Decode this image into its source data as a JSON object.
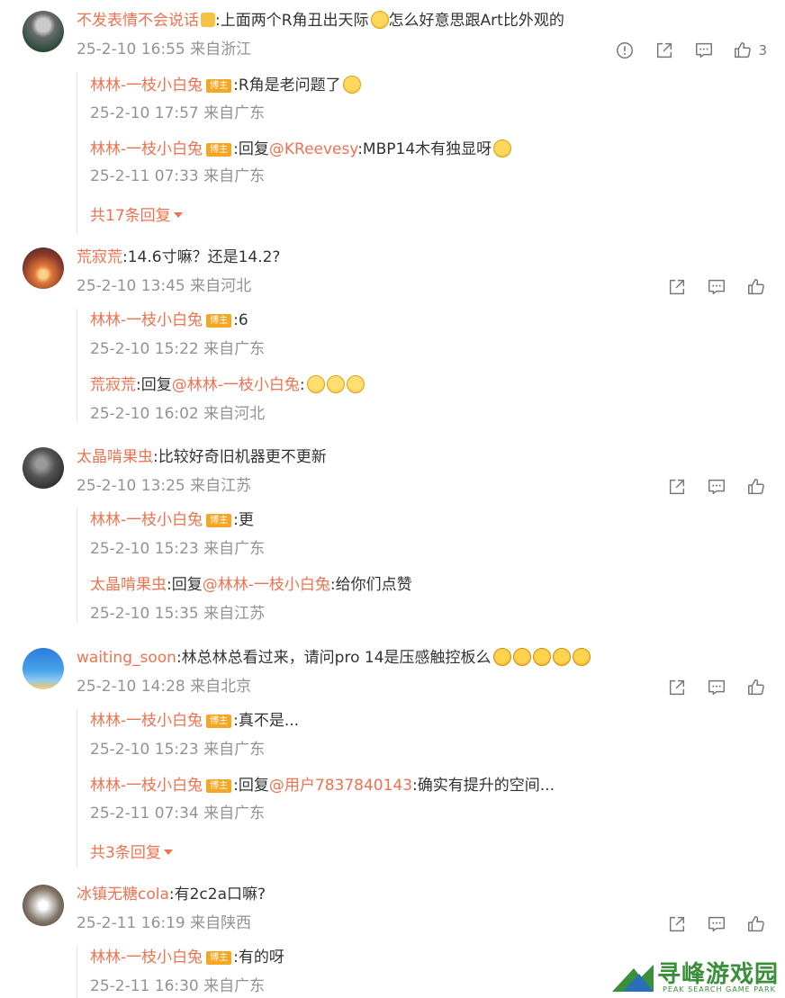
{
  "colors": {
    "username": "#eb7350",
    "meta": "#939393",
    "badge": "#f5a623",
    "watermark": "#3a8f3a"
  },
  "comments": [
    {
      "username": "不发表情不会说话",
      "text": ":上面两个R角丑出天际",
      "text2": "怎么好意思跟Art比外观的",
      "meta": "25-2-10 16:55 来自浙江",
      "likes": "3",
      "replies": [
        {
          "username": "林林-一枝小白兔",
          "badge": "博主",
          "text": ":R角是老问题了",
          "meta": "25-2-10 17:57 来自广东"
        },
        {
          "username": "林林-一枝小白兔",
          "badge": "博主",
          "text_pre": ":回复",
          "mention": "@KReevesy",
          "text": ":MBP14木有独显呀",
          "meta": "25-2-11 07:33 来自广东"
        }
      ],
      "more": "共17条回复"
    },
    {
      "username": "荒寂荒",
      "text": ":14.6寸嘛？还是14.2?",
      "meta": "25-2-10 13:45 来自河北",
      "replies": [
        {
          "username": "林林-一枝小白兔",
          "badge": "博主",
          "text": ":6",
          "meta": "25-2-10 15:22 来自广东"
        },
        {
          "username": "荒寂荒",
          "text_pre": ":回复",
          "mention": "@林林-一枝小白兔",
          "text": ":",
          "meta": "25-2-10 16:02 来自河北"
        }
      ]
    },
    {
      "username": "太晶啃果虫",
      "text": ":比较好奇旧机器更不更新",
      "meta": "25-2-10 13:25 来自江苏",
      "replies": [
        {
          "username": "林林-一枝小白兔",
          "badge": "博主",
          "text": ":更",
          "meta": "25-2-10 15:23 来自广东"
        },
        {
          "username": "太晶啃果虫",
          "text_pre": ":回复",
          "mention": "@林林-一枝小白兔",
          "text": ":给你们点赞",
          "meta": "25-2-10 15:35 来自江苏"
        }
      ]
    },
    {
      "username": "waiting_soon",
      "text": ":林总林总看过来，请问pro 14是压感触控板么",
      "meta": "25-2-10 14:28 来自北京",
      "replies": [
        {
          "username": "林林-一枝小白兔",
          "badge": "博主",
          "text": ":真不是...",
          "meta": "25-2-10 15:23 来自广东"
        },
        {
          "username": "林林-一枝小白兔",
          "badge": "博主",
          "text_pre": ":回复",
          "mention": "@用户7837840143",
          "text": ":确实有提升的空间...",
          "meta": "25-2-11 07:34 来自广东"
        }
      ],
      "more": "共3条回复"
    },
    {
      "username": "冰镇无糖cola",
      "text": ":有2c2a口嘛?",
      "meta": "25-2-11 16:19 来自陕西",
      "replies": [
        {
          "username": "林林-一枝小白兔",
          "badge": "博主",
          "text": ":有的呀",
          "meta": "25-2-11 16:30 来自广东"
        }
      ]
    }
  ],
  "icons": {
    "report": "report-icon",
    "share": "share-icon",
    "comment": "comment-icon",
    "like": "like-icon"
  },
  "watermark": {
    "title": "寻峰游戏园",
    "subtitle": "PEAK SEARCH GAME PARK"
  }
}
